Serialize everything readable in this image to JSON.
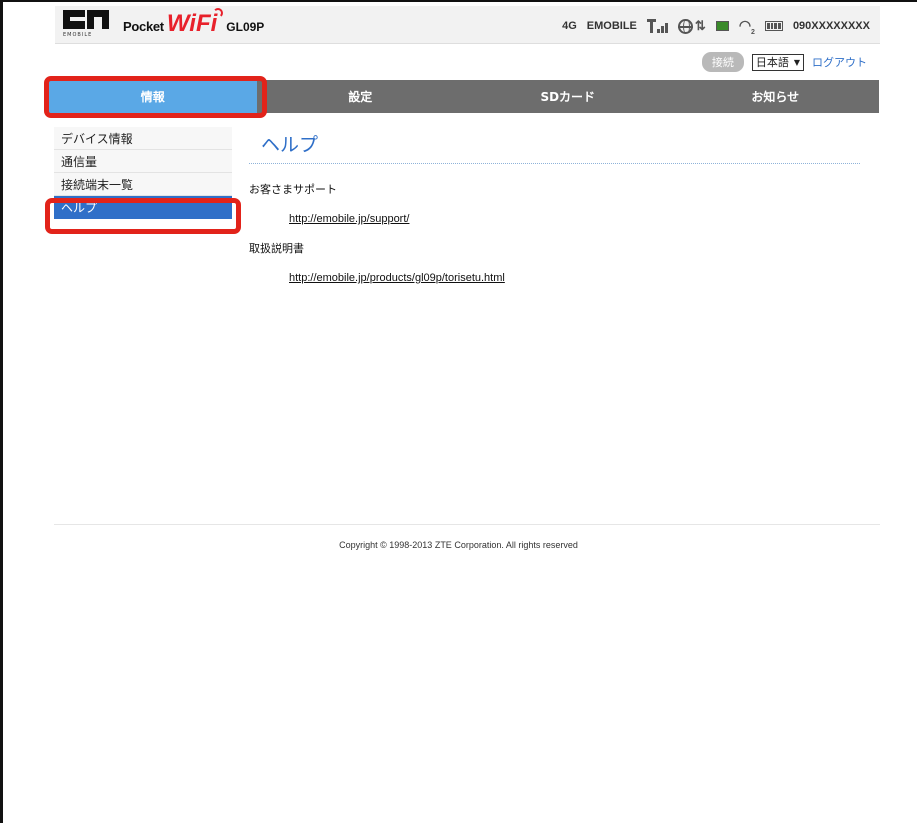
{
  "header": {
    "brand_sub": "EMOBILE",
    "brand_pocket": "Pocket",
    "brand_wifi": "WiFi",
    "model": "GL09P",
    "network_type": "4G",
    "carrier": "EMOBILE",
    "wifi_clients": "2",
    "phone_number": "090XXXXXXXX"
  },
  "utility": {
    "connect_label": "接続",
    "language": "日本語",
    "logout_label": "ログアウト"
  },
  "nav": {
    "tabs": [
      {
        "label": "情報"
      },
      {
        "label": "設定"
      },
      {
        "label": "SDカード"
      },
      {
        "label": "お知らせ"
      }
    ]
  },
  "sidebar": {
    "items": [
      {
        "label": "デバイス情報"
      },
      {
        "label": "通信量"
      },
      {
        "label": "接続端末一覧"
      },
      {
        "label": "ヘルプ"
      }
    ]
  },
  "main": {
    "title": "ヘルプ",
    "support_label": "お客さまサポート",
    "support_link": "http://emobile.jp/support/",
    "manual_label": "取扱説明書",
    "manual_link": "http://emobile.jp/products/gl09p/torisetu.html"
  },
  "footer": {
    "copyright": "Copyright © 1998-2013 ZTE Corporation. All rights reserved"
  },
  "colors": {
    "accent": "#2f6fc8",
    "nav_active": "#5aa8e6",
    "nav_bg": "#6d6d6d",
    "callout": "#e2231a",
    "brand_red": "#e8212b"
  }
}
